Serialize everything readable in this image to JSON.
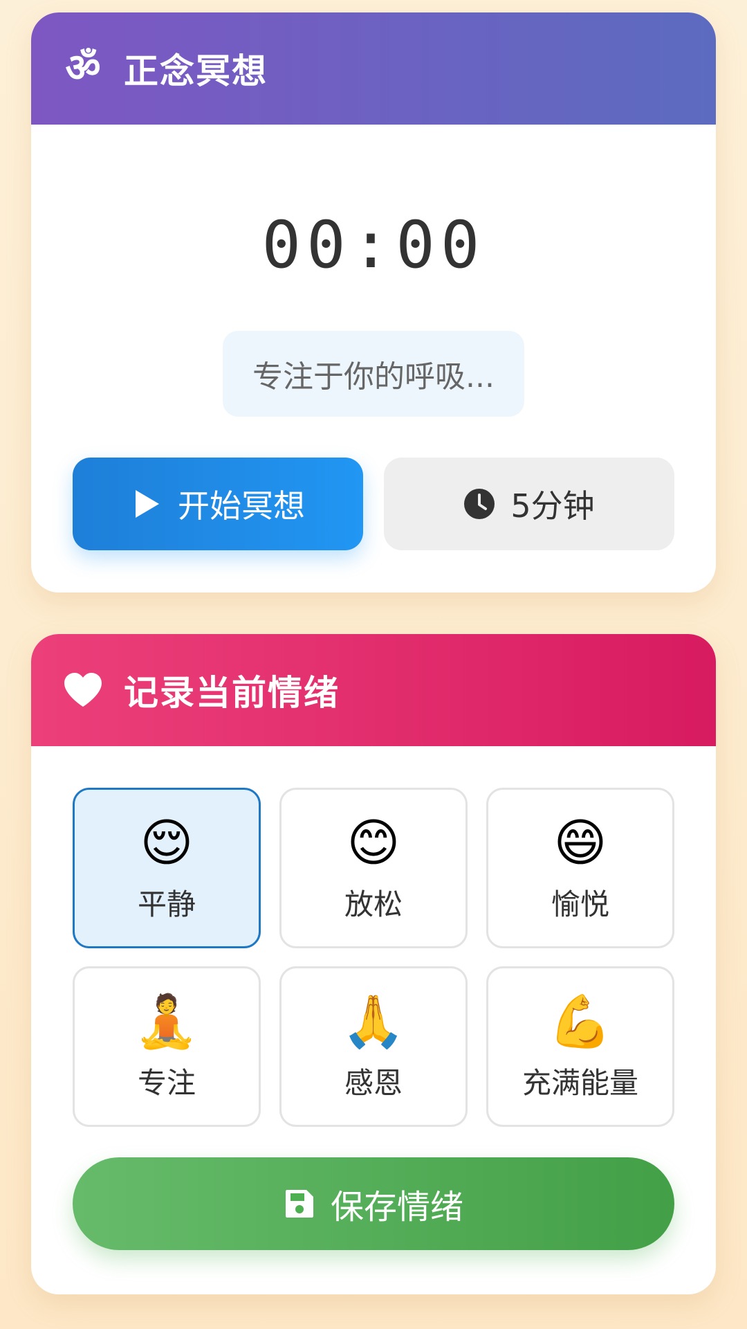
{
  "meditation": {
    "title": "正念冥想",
    "icon": "om-icon",
    "timer": "00:00",
    "hint": "专注于你的呼吸...",
    "start_label": "开始冥想",
    "start_icon": "play-icon",
    "duration_label": "5分钟",
    "duration_icon": "clock-icon"
  },
  "mood": {
    "title": "记录当前情绪",
    "icon": "heart-icon",
    "options": [
      {
        "emoji": "😌",
        "label": "平静",
        "selected": true
      },
      {
        "emoji": "😊",
        "label": "放松",
        "selected": false
      },
      {
        "emoji": "😄",
        "label": "愉悦",
        "selected": false
      },
      {
        "emoji": "🧘",
        "label": "专注",
        "selected": false
      },
      {
        "emoji": "🙏",
        "label": "感恩",
        "selected": false
      },
      {
        "emoji": "💪",
        "label": "充满能量",
        "selected": false
      }
    ],
    "save_label": "保存情绪",
    "save_icon": "save-icon"
  },
  "colors": {
    "meditation_header": "#7e57c2",
    "mood_header": "#ec407a",
    "start_button": "#2196f3",
    "save_button": "#4caf50",
    "selected_border": "#1f78c4",
    "selected_fill": "#e3f1fd"
  }
}
